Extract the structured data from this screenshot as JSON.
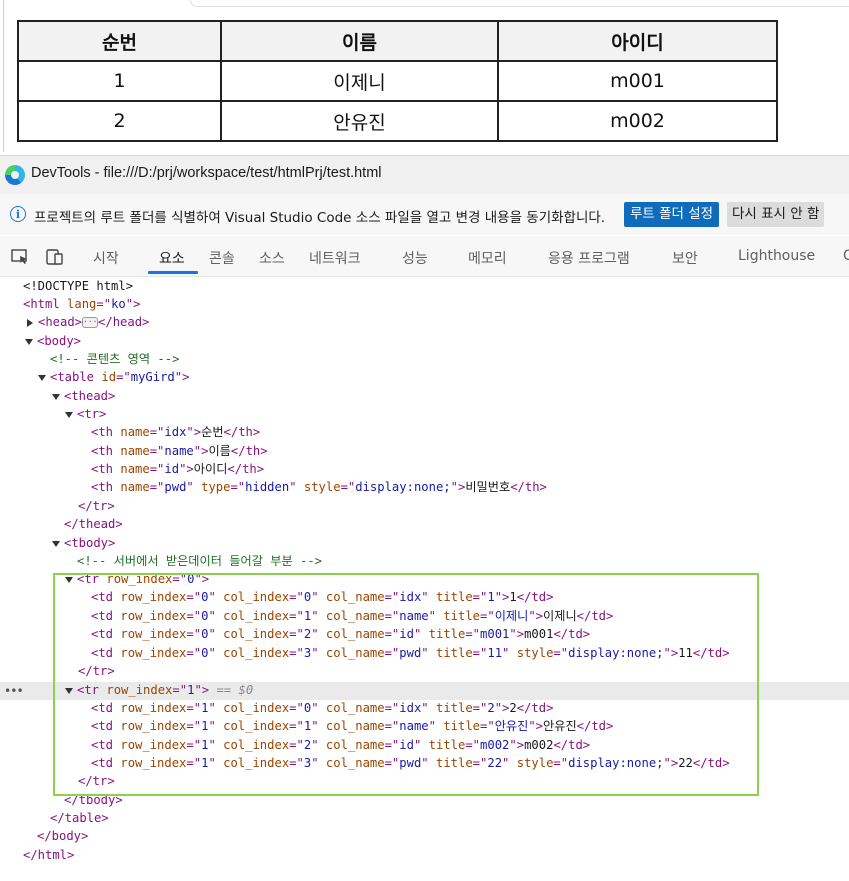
{
  "page_table": {
    "headers": [
      "순번",
      "이름",
      "아이디"
    ],
    "rows": [
      [
        "1",
        "이제니",
        "m001"
      ],
      [
        "2",
        "안유진",
        "m002"
      ]
    ]
  },
  "devtools": {
    "title": "DevTools - file:///D:/prj/workspace/test/htmlPrj/test.html",
    "info_message": "프로젝트의 루트 폴더를 식별하여 Visual Studio Code 소스 파일을 열고 변경 내용을 동기화합니다.",
    "set_root_button": "루트 폴더 설정",
    "dont_show_button": "다시 표시 안 함",
    "tabs": [
      "시작",
      "요소",
      "콘솔",
      "소스",
      "네트워크",
      "성능",
      "메모리",
      "응용 프로그램",
      "보안",
      "Lighthouse",
      "C"
    ],
    "active_tab": "요소"
  },
  "dom": {
    "doctype": "<!DOCTYPE html>",
    "html_lang": "ko",
    "comment_content": "<!-- 콘텐츠 영역 -->",
    "table_id": "myGird",
    "th": [
      {
        "name": "idx",
        "text": "순번"
      },
      {
        "name": "name",
        "text": "이름"
      },
      {
        "name": "id",
        "text": "아이디"
      },
      {
        "name": "pwd",
        "type": "hidden",
        "style": "display:none;",
        "text": "비밀번호"
      }
    ],
    "comment_tbody": "<!-- 서버에서 받은데이터 들어갈 부분 -->",
    "rows": [
      {
        "row_index": "0",
        "cells": [
          {
            "col_index": "0",
            "col_name": "idx",
            "title": "1",
            "text": "1"
          },
          {
            "col_index": "1",
            "col_name": "name",
            "title": "이제니",
            "text": "이제니"
          },
          {
            "col_index": "2",
            "col_name": "id",
            "title": "m001",
            "text": "m001"
          },
          {
            "col_index": "3",
            "col_name": "pwd",
            "title": "11",
            "style": "display:none;",
            "text": "11"
          }
        ]
      },
      {
        "row_index": "1",
        "selected_marker": "== $0",
        "cells": [
          {
            "col_index": "0",
            "col_name": "idx",
            "title": "2",
            "text": "2"
          },
          {
            "col_index": "1",
            "col_name": "name",
            "title": "안유진",
            "text": "안유진"
          },
          {
            "col_index": "2",
            "col_name": "id",
            "title": "m002",
            "text": "m002"
          },
          {
            "col_index": "3",
            "col_name": "pwd",
            "title": "22",
            "style": "display:none;",
            "text": "22"
          }
        ]
      }
    ]
  },
  "colors": {
    "tag": "#881280",
    "attr_name": "#994500",
    "attr_value": "#1a1aa6",
    "comment": "#236e25",
    "accent": "#1a73e8",
    "primary_button": "#0f6cbd",
    "highlight_box": "#8cd14c"
  },
  "icons": [
    "edge-logo-icon",
    "info-icon",
    "inspect-element-icon",
    "device-emulation-icon",
    "expand-triangle-icon",
    "collapse-triangle-icon",
    "ellipsis-icon"
  ]
}
